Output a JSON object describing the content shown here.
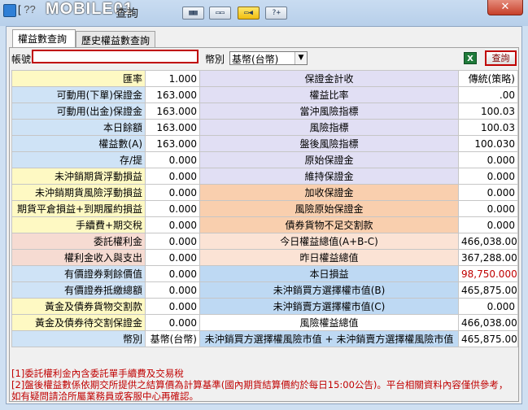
{
  "window": {
    "title_icon": "app-icon",
    "title_prefix": "[ ",
    "title_box": "??",
    "logo_watermark": "MOBILE01",
    "title_suffix": "查詢",
    "toolbar_buttons": [
      {
        "name": "grid-view-button",
        "glyph": "▦▦"
      },
      {
        "name": "window-restore-button",
        "glyph": "▭▭"
      },
      {
        "name": "pin-button",
        "glyph": "▭◀"
      },
      {
        "name": "help-button",
        "glyph": "?+"
      }
    ],
    "close_glyph": "✕"
  },
  "tabs": [
    {
      "label": "權益數查詢",
      "active": true
    },
    {
      "label": "歷史權益數查詢",
      "active": false
    }
  ],
  "controls": {
    "account_label": "帳號",
    "account_value": "",
    "currency_label": "幣別",
    "currency_selected": "基幣(台幣)",
    "export_icon": "X",
    "query_label": "查詢"
  },
  "rows": [
    {
      "l1": "匯率",
      "v1": "1.000",
      "l2": "保證金計收",
      "v2": "傳統(策略)"
    },
    {
      "l1": "可動用(下單)保證金",
      "v1": "163.000",
      "l2": "權益比率",
      "v2": ".00"
    },
    {
      "l1": "可動用(出金)保證金",
      "v1": "163.000",
      "l2": "當沖風險指標",
      "v2": "100.03"
    },
    {
      "l1": "本日餘額",
      "v1": "163.000",
      "l2": "風險指標",
      "v2": "100.03"
    },
    {
      "l1": "權益數(A)",
      "v1": "163.000",
      "l2": "盤後風險指標",
      "v2": "100.030"
    },
    {
      "l1": "存/提",
      "v1": "0.000",
      "l2": "原始保證金",
      "v2": "0.000"
    },
    {
      "l1": "未沖銷期貨浮動損益",
      "v1": "0.000",
      "l2": "維持保證金",
      "v2": "0.000"
    },
    {
      "l1": "未沖銷期貨風險浮動損益",
      "v1": "0.000",
      "l2": "加收保證金",
      "v2": "0.000"
    },
    {
      "l1": "期貨平倉損益+到期履約損益",
      "v1": "0.000",
      "l2": "風險原始保證金",
      "v2": "0.000"
    },
    {
      "l1": "手續費+期交稅",
      "v1": "0.000",
      "l2": "債券貨物不足交割款",
      "v2": "0.000"
    },
    {
      "l1": "委託權利金",
      "v1": "0.000",
      "l2": "今日權益總值(A+B-C)",
      "v2": "466,038.000"
    },
    {
      "l1": "權利金收入與支出",
      "v1": "0.000",
      "l2": "昨日權益總值",
      "v2": "367,288.000"
    },
    {
      "l1": "有價證券剩餘價值",
      "v1": "0.000",
      "l2": "本日損益",
      "v2": "98,750.000"
    },
    {
      "l1": "有價證券抵繳總額",
      "v1": "0.000",
      "l2": "未沖銷買方選擇權市值(B)",
      "v2": "465,875.000"
    },
    {
      "l1": "黃金及債券貨物交割款",
      "v1": "0.000",
      "l2": "未沖銷賣方選擇權市值(C)",
      "v2": "0.000"
    },
    {
      "l1": "黃金及債券待交割保證金",
      "v1": "0.000",
      "l2": "風險權益總值",
      "v2": "466,038.000"
    },
    {
      "l1": "幣別",
      "v1": "基幣(台幣)",
      "l2": "未沖銷買方選擇權風險市值 + 未沖銷賣方選擇權風險市值",
      "v2": "465,875.000"
    }
  ],
  "notes": [
    "[1]委託權利金內含委託單手續費及交易稅",
    "[2]盤後權益數係依期交所提供之結算價為計算基準(國內期貨結算價約於每日15:00公告)。平台相關資料內容僅供參考，",
    "如有疑問請洽所屬業務員或客服中心再確認。"
  ],
  "colors": {
    "highlight_red": "#c00000",
    "label_yellow": "#fef9c3",
    "label_blue": "#cfe3f6",
    "label_pink": "#f6dbd2"
  }
}
